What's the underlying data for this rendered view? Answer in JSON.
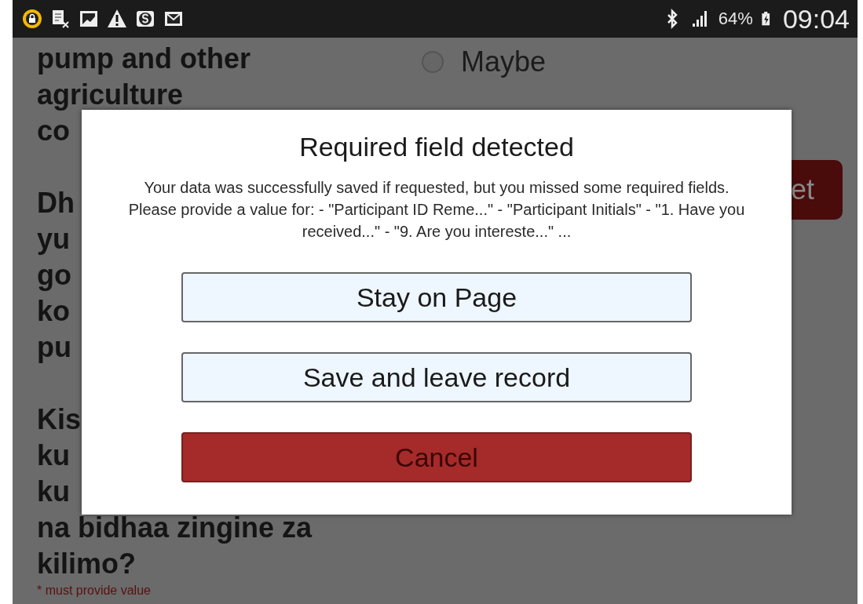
{
  "status_bar": {
    "battery": "64%",
    "time": "09:04"
  },
  "form": {
    "questions": [
      {
        "lines": [
          "pump and other",
          "agriculture",
          "co"
        ]
      },
      {
        "lines": [
          "Dh",
          "yu",
          "go",
          "ko",
          "pu"
        ]
      },
      {
        "lines": [
          "Kis",
          "ku",
          "ku",
          "na bidhaa zingine za",
          "kilimo?"
        ]
      }
    ],
    "required_note": "* must provide value",
    "option": {
      "label": "Maybe",
      "selected": false
    },
    "button_fragment": "et"
  },
  "dialog": {
    "title": "Required field detected",
    "message": "Your data was successfully saved if requested, but you missed some required fields. Please provide a value for: - \"Participant ID Reme...\" - \"Participant Initials\" - \"1. Have you received...\" - \"9. Are you intereste...\" ...",
    "buttons": [
      {
        "label": "Stay on Page",
        "kind": "secondary"
      },
      {
        "label": "Save and leave record",
        "kind": "secondary"
      },
      {
        "label": "Cancel",
        "kind": "danger"
      }
    ]
  }
}
